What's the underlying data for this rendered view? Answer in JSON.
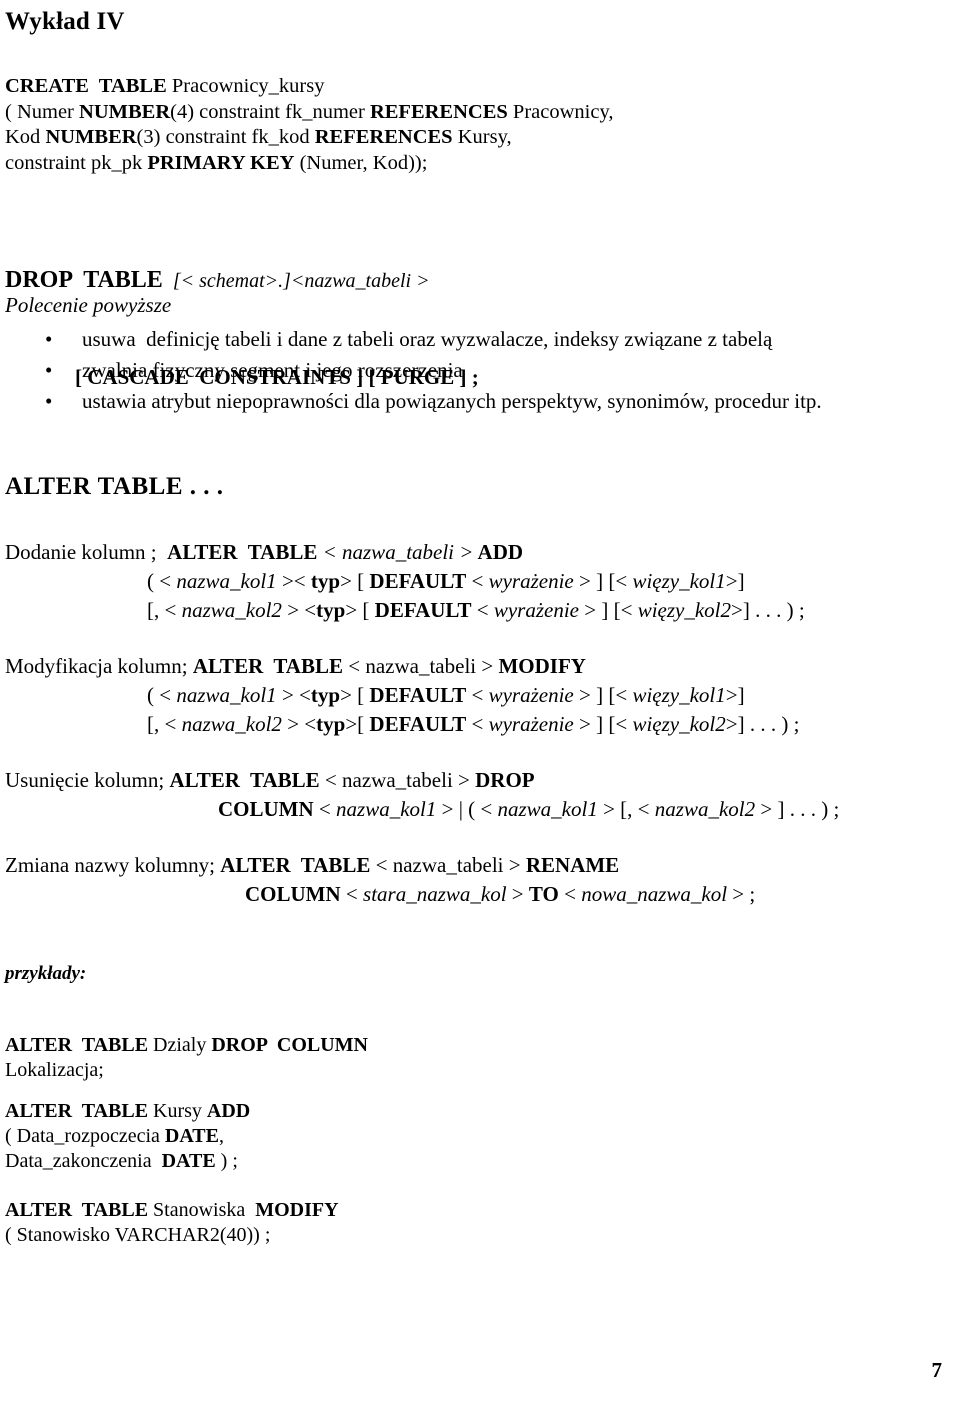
{
  "document": {
    "title": "Wykład IV",
    "page_number": "7"
  },
  "create_table": {
    "lines": [
      [
        {
          "t": "CREATE  TABLE ",
          "s": "b"
        },
        {
          "t": "Pracownicy_kursy",
          "s": ""
        }
      ],
      [
        {
          "t": "( Numer ",
          "s": ""
        },
        {
          "t": "NUMBER",
          "s": "b"
        },
        {
          "t": "(4) constraint fk_numer ",
          "s": ""
        },
        {
          "t": "REFERENCES",
          "s": "b"
        },
        {
          "t": " Pracownicy,",
          "s": ""
        }
      ],
      [
        {
          "t": "Kod ",
          "s": ""
        },
        {
          "t": "NUMBER",
          "s": "b"
        },
        {
          "t": "(3) constraint fk_kod ",
          "s": ""
        },
        {
          "t": "REFERENCES",
          "s": "b"
        },
        {
          "t": " Kursy,",
          "s": ""
        }
      ],
      [
        {
          "t": "constraint pk_pk ",
          "s": ""
        },
        {
          "t": "PRIMARY KEY",
          "s": "b"
        },
        {
          "t": " (Numer, Kod));",
          "s": ""
        }
      ]
    ]
  },
  "drop_table": {
    "line1_keyword": "DROP  TABLE",
    "line1_params": "  [< schemat>.]<nazwa_tabeli >",
    "line2": "[ CASCADE  CONSTRAINTS ] [ PURGE ] ;"
  },
  "polecenie": {
    "label": "Polecenie powyższe",
    "bullet_char": "•",
    "items": [
      "usuwa  definicję tabeli i dane z tabeli oraz wyzwalacze, indeksy związane z tabelą",
      "zwalnia fizyczny segment i jego rozszerzenia",
      "ustawia atrybut niepoprawności dla powiązanych perspektyw, synonimów, procedur itp."
    ]
  },
  "alter_table": {
    "heading": "ALTER  TABLE . . .",
    "groups": [
      {
        "name": "add",
        "head": [
          {
            "t": "Dodanie kolumn ;  ",
            "s": ""
          },
          {
            "t": "ALTER  TABLE",
            "s": "b"
          },
          {
            "t": " < nazwa_tabeli >",
            "s": "i"
          },
          {
            "t": " ADD",
            "s": "b"
          }
        ],
        "conts": [
          {
            "indent": "ind-147",
            "parts": [
              {
                "t": "( < ",
                "s": ""
              },
              {
                "t": "nazwa_kol1",
                "s": "i"
              },
              {
                "t": " >< ",
                "s": ""
              },
              {
                "t": "typ",
                "s": "b"
              },
              {
                "t": "> [ ",
                "s": ""
              },
              {
                "t": "DEFAULT",
                "s": "b"
              },
              {
                "t": " < ",
                "s": ""
              },
              {
                "t": "wyrażenie",
                "s": "i"
              },
              {
                "t": " > ] [< ",
                "s": ""
              },
              {
                "t": "więzy_kol1",
                "s": "i"
              },
              {
                "t": ">]",
                "s": ""
              }
            ]
          },
          {
            "indent": "ind-147",
            "parts": [
              {
                "t": "[, < ",
                "s": ""
              },
              {
                "t": "nazwa_kol2",
                "s": "i"
              },
              {
                "t": " > <",
                "s": ""
              },
              {
                "t": "typ",
                "s": "b"
              },
              {
                "t": "> [ ",
                "s": ""
              },
              {
                "t": "DEFAULT",
                "s": "b"
              },
              {
                "t": " < ",
                "s": ""
              },
              {
                "t": "wyrażenie",
                "s": "i"
              },
              {
                "t": " > ] [< ",
                "s": ""
              },
              {
                "t": "więzy_kol2",
                "s": "i"
              },
              {
                "t": ">] . . . ) ;",
                "s": ""
              }
            ]
          }
        ]
      },
      {
        "name": "modify",
        "head": [
          {
            "t": "Modyfikacja kolumn; ",
            "s": ""
          },
          {
            "t": "ALTER  TABLE",
            "s": "b"
          },
          {
            "t": " < nazwa_tabeli > ",
            "s": ""
          },
          {
            "t": "MODIFY",
            "s": "b"
          }
        ],
        "conts": [
          {
            "indent": "ind-147",
            "parts": [
              {
                "t": "( < ",
                "s": ""
              },
              {
                "t": "nazwa_kol1",
                "s": "i"
              },
              {
                "t": " > <",
                "s": ""
              },
              {
                "t": "typ",
                "s": "b"
              },
              {
                "t": "> [ ",
                "s": ""
              },
              {
                "t": "DEFAULT",
                "s": "b"
              },
              {
                "t": " < ",
                "s": ""
              },
              {
                "t": "wyrażenie",
                "s": "i"
              },
              {
                "t": " > ] [< ",
                "s": ""
              },
              {
                "t": "więzy_kol1",
                "s": "i"
              },
              {
                "t": ">]",
                "s": ""
              }
            ]
          },
          {
            "indent": "ind-147",
            "parts": [
              {
                "t": "[, < ",
                "s": ""
              },
              {
                "t": "nazwa_kol2",
                "s": "i"
              },
              {
                "t": " > <",
                "s": ""
              },
              {
                "t": "typ",
                "s": "b"
              },
              {
                "t": ">[ ",
                "s": ""
              },
              {
                "t": "DEFAULT",
                "s": "b"
              },
              {
                "t": " < ",
                "s": ""
              },
              {
                "t": "wyrażenie",
                "s": "i"
              },
              {
                "t": " > ] [< ",
                "s": ""
              },
              {
                "t": "więzy_kol2",
                "s": "i"
              },
              {
                "t": ">] . . . ) ;",
                "s": ""
              }
            ]
          }
        ]
      },
      {
        "name": "drop",
        "head": [
          {
            "t": "Usunięcie kolumn; ",
            "s": ""
          },
          {
            "t": "ALTER  TABLE",
            "s": "b"
          },
          {
            "t": " < nazwa_tabeli > ",
            "s": ""
          },
          {
            "t": "DROP",
            "s": "b"
          }
        ],
        "conts": [
          {
            "indent": "ind-218",
            "parts": [
              {
                "t": "COLUMN",
                "s": "b"
              },
              {
                "t": " < ",
                "s": ""
              },
              {
                "t": "nazwa_kol1",
                "s": "i"
              },
              {
                "t": " > | ( < ",
                "s": ""
              },
              {
                "t": "nazwa_kol1",
                "s": "i"
              },
              {
                "t": " > [, < ",
                "s": ""
              },
              {
                "t": "nazwa_kol2",
                "s": "i"
              },
              {
                "t": " > ] . . . ) ;",
                "s": ""
              }
            ]
          }
        ]
      },
      {
        "name": "rename",
        "head": [
          {
            "t": "Zmiana nazwy kolumny; ",
            "s": ""
          },
          {
            "t": "ALTER  TABLE",
            "s": "b"
          },
          {
            "t": " < nazwa_tabeli > ",
            "s": ""
          },
          {
            "t": "RENAME",
            "s": "b"
          }
        ],
        "conts": [
          {
            "indent": "ind-243",
            "parts": [
              {
                "t": "COLUMN",
                "s": "b"
              },
              {
                "t": " < ",
                "s": ""
              },
              {
                "t": "stara_nazwa_kol",
                "s": "i"
              },
              {
                "t": " > ",
                "s": ""
              },
              {
                "t": "TO",
                "s": "b"
              },
              {
                "t": " < ",
                "s": ""
              },
              {
                "t": "nowa_nazwa_kol",
                "s": "i"
              },
              {
                "t": " > ;",
                "s": ""
              }
            ]
          }
        ]
      }
    ]
  },
  "examples": {
    "label": "przykłady:",
    "items": [
      {
        "name": "alter-dzialy-drop-column",
        "lines": [
          [
            {
              "t": "ALTER  TABLE",
              "s": "b"
            },
            {
              "t": " Dzialy ",
              "s": ""
            },
            {
              "t": "DROP  COLUMN",
              "s": "b"
            }
          ],
          [
            {
              "t": "Lokalizacja;",
              "s": ""
            }
          ]
        ]
      },
      {
        "name": "alter-kursy-add",
        "lines": [
          [
            {
              "t": "ALTER  TABLE",
              "s": "b"
            },
            {
              "t": " Kursy ",
              "s": ""
            },
            {
              "t": "ADD",
              "s": "b"
            }
          ],
          [
            {
              "t": "( Data_rozpoczecia ",
              "s": ""
            },
            {
              "t": "DATE",
              "s": "b"
            },
            {
              "t": ",",
              "s": ""
            }
          ],
          [
            {
              "t": "Data_zakonczenia  ",
              "s": ""
            },
            {
              "t": "DATE",
              "s": "b"
            },
            {
              "t": " ) ;",
              "s": ""
            }
          ]
        ]
      },
      {
        "name": "alter-stanowiska-modify",
        "lines": [
          [
            {
              "t": "ALTER  TABLE",
              "s": "b"
            },
            {
              "t": " Stanowiska  ",
              "s": ""
            },
            {
              "t": "MODIFY",
              "s": "b"
            }
          ],
          [
            {
              "t": "( Stanowisko VARCHAR2(40)) ;",
              "s": ""
            }
          ]
        ]
      }
    ]
  }
}
